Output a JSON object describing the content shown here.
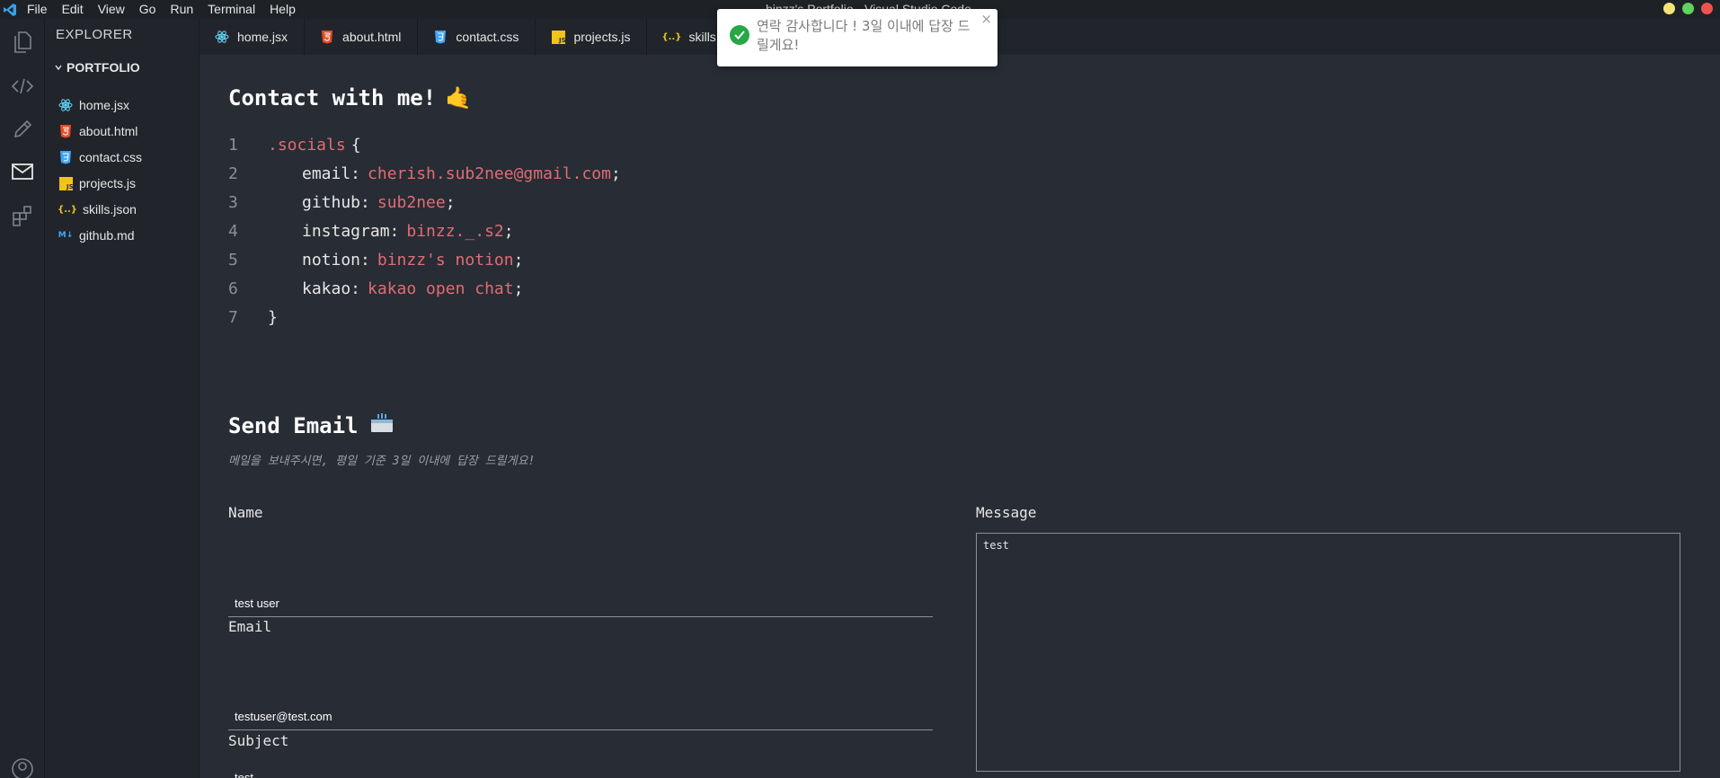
{
  "window": {
    "title": "binzz's Portfolio - Visual Studio Code",
    "menu": [
      "File",
      "Edit",
      "View",
      "Go",
      "Run",
      "Terminal",
      "Help"
    ],
    "controls_colors": [
      "#f5e27a",
      "#5fd35f",
      "#ef5350"
    ]
  },
  "activity_bar": {
    "items": [
      {
        "icon": "files-icon"
      },
      {
        "icon": "code-icon"
      },
      {
        "icon": "pencil-icon"
      },
      {
        "icon": "mail-icon",
        "active": true
      },
      {
        "icon": "extensions-icon"
      },
      {
        "icon": "account-icon"
      }
    ]
  },
  "explorer": {
    "title": "EXPLORER",
    "folder": "PORTFOLIO",
    "files": [
      {
        "name": "home.jsx",
        "icon": "react-icon"
      },
      {
        "name": "about.html",
        "icon": "html-icon"
      },
      {
        "name": "contact.css",
        "icon": "css-icon"
      },
      {
        "name": "projects.js",
        "icon": "js-icon"
      },
      {
        "name": "skills.json",
        "icon": "json-icon"
      },
      {
        "name": "github.md",
        "icon": "markdown-icon"
      }
    ]
  },
  "tabs": [
    {
      "label": "home.jsx",
      "icon": "react-icon"
    },
    {
      "label": "about.html",
      "icon": "html-icon"
    },
    {
      "label": "contact.css",
      "icon": "css-icon"
    },
    {
      "label": "projects.js",
      "icon": "js-icon"
    },
    {
      "label": "skills.json",
      "icon": "json-icon"
    }
  ],
  "contact": {
    "heading": "Contact with me!",
    "heading_emoji": "🤙",
    "code": {
      "line_numbers": [
        "1",
        "2",
        "3",
        "4",
        "5",
        "6",
        "7"
      ],
      "selector": ".socials",
      "open_brace": "{",
      "close_brace": "}",
      "entries": [
        {
          "key": "email:",
          "value": "cherish.sub2nee@gmail.com"
        },
        {
          "key": "github:",
          "value": "sub2nee"
        },
        {
          "key": "instagram:",
          "value": "binzz._.s2"
        },
        {
          "key": "notion:",
          "value": "binzz's notion"
        },
        {
          "key": "kakao:",
          "value": "kakao open chat"
        }
      ],
      "semicolon": ";"
    }
  },
  "send_email": {
    "heading": "Send Email",
    "subtitle": "메일을 보내주시면, 평일 기준 3일 이내에 답장 드릴게요!",
    "fields": {
      "name_label": "Name",
      "name_value": "test user",
      "email_label": "Email",
      "email_value": "testuser@test.com",
      "subject_label": "Subject",
      "subject_value": "test",
      "message_label": "Message",
      "message_value": "test"
    }
  },
  "toast": {
    "message": "연락 감사합니다 ! 3일 이내에 답장 드릴게요!",
    "close": "×",
    "color": "#27a745"
  },
  "colors": {
    "editor_bg": "#282c34",
    "sidebar_bg": "#21252b",
    "accent_value": "#e06c75"
  }
}
